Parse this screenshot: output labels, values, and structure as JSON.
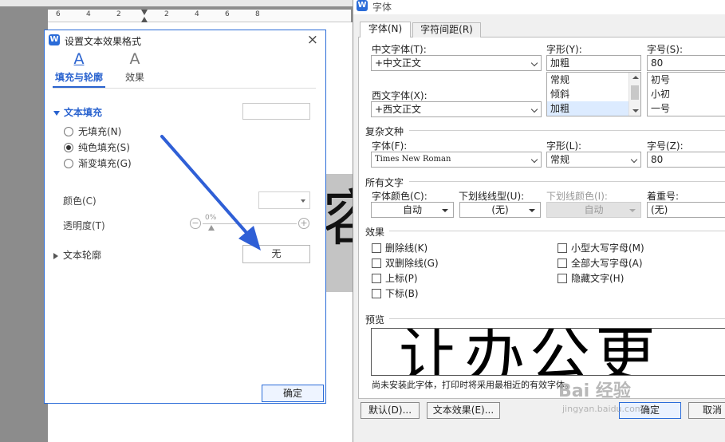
{
  "ruler": {
    "numbers": [
      "6",
      "4",
      "2",
      "2",
      "4",
      "6",
      "8"
    ]
  },
  "document": {
    "visible_char": "容"
  },
  "effects_panel": {
    "title": "设置文本效果格式",
    "close": "×",
    "tabs": [
      {
        "icon": "A",
        "label": "填充与轮廓"
      },
      {
        "icon": "A",
        "label": "效果"
      }
    ],
    "fill_section": "文本填充",
    "fill_options": [
      "无填充(N)",
      "纯色填充(S)",
      "渐变填充(G)"
    ],
    "selected_fill": "纯色填充(S)",
    "color_label": "颜色(C)",
    "transparency_label": "透明度(T)",
    "transparency_value": "0%",
    "minus": "−",
    "plus": "+",
    "outline_section": "文本轮廓",
    "outline_value": "无",
    "ok": "确定"
  },
  "font_dialog": {
    "title": "字体",
    "tabs": [
      "字体(N)",
      "字符间距(R)"
    ],
    "cn_font_label": "中文字体(T):",
    "cn_font_value": "+中文正文",
    "style_label": "字形(Y):",
    "style_value": "加粗",
    "style_options": [
      "常规",
      "倾斜",
      "加粗"
    ],
    "size_label": "字号(S):",
    "size_value": "80",
    "size_options": [
      "初号",
      "小初",
      "一号"
    ],
    "west_font_label": "西文字体(X):",
    "west_font_value": "+西文正文",
    "complex_group": "复杂文种",
    "complex_font_label": "字体(F):",
    "complex_font_value": "Times New Roman",
    "complex_style_label": "字形(L):",
    "complex_style_value": "常规",
    "complex_size_label": "字号(Z):",
    "complex_size_value": "80",
    "all_text_group": "所有文字",
    "font_color_label": "字体颜色(C):",
    "font_color_value": "自动",
    "underline_style_label": "下划线线型(U):",
    "underline_style_value": "(无)",
    "underline_color_label": "下划线颜色(I):",
    "underline_color_value": "自动",
    "emphasis_label": "着重号:",
    "emphasis_value": "(无)",
    "effects_group": "效果",
    "effects_left": [
      "删除线(K)",
      "双删除线(G)",
      "上标(P)",
      "下标(B)"
    ],
    "effects_right": [
      "小型大写字母(M)",
      "全部大写字母(A)",
      "隐藏文字(H)"
    ],
    "preview_group": "预览",
    "preview_text": "让办公更",
    "preview_note": "尚未安装此字体，打印时将采用最相近的有效字体。",
    "buttons": {
      "default": "默认(D)...",
      "text_effect": "文本效果(E)...",
      "ok": "确定",
      "cancel": "取消"
    }
  },
  "watermark": {
    "logo": "Bai 经验",
    "url": "jingyan.baidu.com"
  },
  "colors": {
    "accent": "#2b6cd8",
    "arrow": "#2f5fd6"
  }
}
